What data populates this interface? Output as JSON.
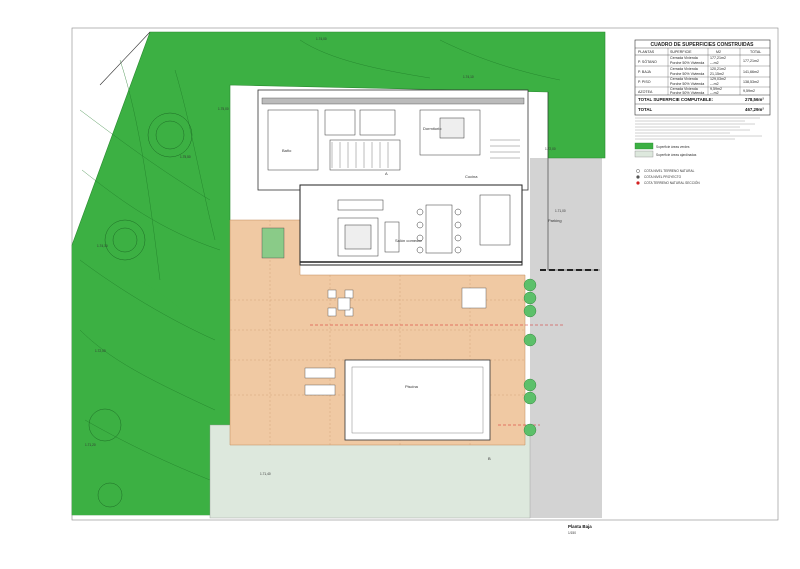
{
  "legend_table": {
    "title": "CUADRO DE SUPERFICIES CONSTRUIDAS",
    "headers": [
      "PLANTAS",
      "SUPERFICIE",
      "M2",
      "TOTAL"
    ],
    "rows": [
      {
        "floor": "P. SÓTANO",
        "items": [
          [
            "Cerrada Vivienda",
            "177,21m2"
          ],
          [
            "Porche 50% Vivienda",
            "---m2"
          ]
        ],
        "total": "177,21m2"
      },
      {
        "floor": "P. BAJA",
        "items": [
          [
            "Cerrada Vivienda",
            "120,21m2"
          ],
          [
            "Porche 50% Vivienda",
            "21,15m2"
          ]
        ],
        "total": "141,66m2"
      },
      {
        "floor": "P. PISO",
        "items": [
          [
            "Cerrada Vivienda",
            "129,03m2"
          ],
          [
            "Porche 50% Vivienda",
            "---m2"
          ]
        ],
        "total": "138,53m2"
      },
      {
        "floor": "AZOTEA",
        "items": [
          [
            "Cerrada Vivienda",
            "9,59m2"
          ],
          [
            "Porche 50% Vivienda",
            "---m2"
          ]
        ],
        "total": "9,59m2"
      }
    ],
    "computable_label": "TOTAL SUPERFICIE COMPUTABLE:",
    "computable_value": "278,56m²",
    "total_label": "TOTAL",
    "total_value": "467,29m²"
  },
  "legend_keys": {
    "green_label": "Superficie áreas verdes",
    "light_label": "Superficie áreas ajardinadas"
  },
  "level_keys": [
    {
      "label": "COTA NIVEL TERRENO NATURAL",
      "color": "#555555"
    },
    {
      "label": "COTA NIVEL PROYECTO",
      "color": "#555555"
    },
    {
      "label": "COTA TERRENO NATURAL SECCIÓN",
      "color": "#d32020"
    }
  ],
  "room_labels": {
    "pool": "Piscina",
    "parking": "Parking",
    "bath": "Baño",
    "bedroom": "Dormitorio",
    "kitchen": "Cocina",
    "living": "Salón comedor"
  },
  "section_marks": {
    "section_a": "A",
    "section_b": "B"
  },
  "plan_title": "Planta Baja",
  "plan_scale": "1/150",
  "colors": {
    "grass": "#3cb043",
    "grass_dark": "#2e9a36",
    "terrace": "#f0c9a3",
    "light_lawn": "#dde8dd",
    "road": "#d3d3d3"
  }
}
